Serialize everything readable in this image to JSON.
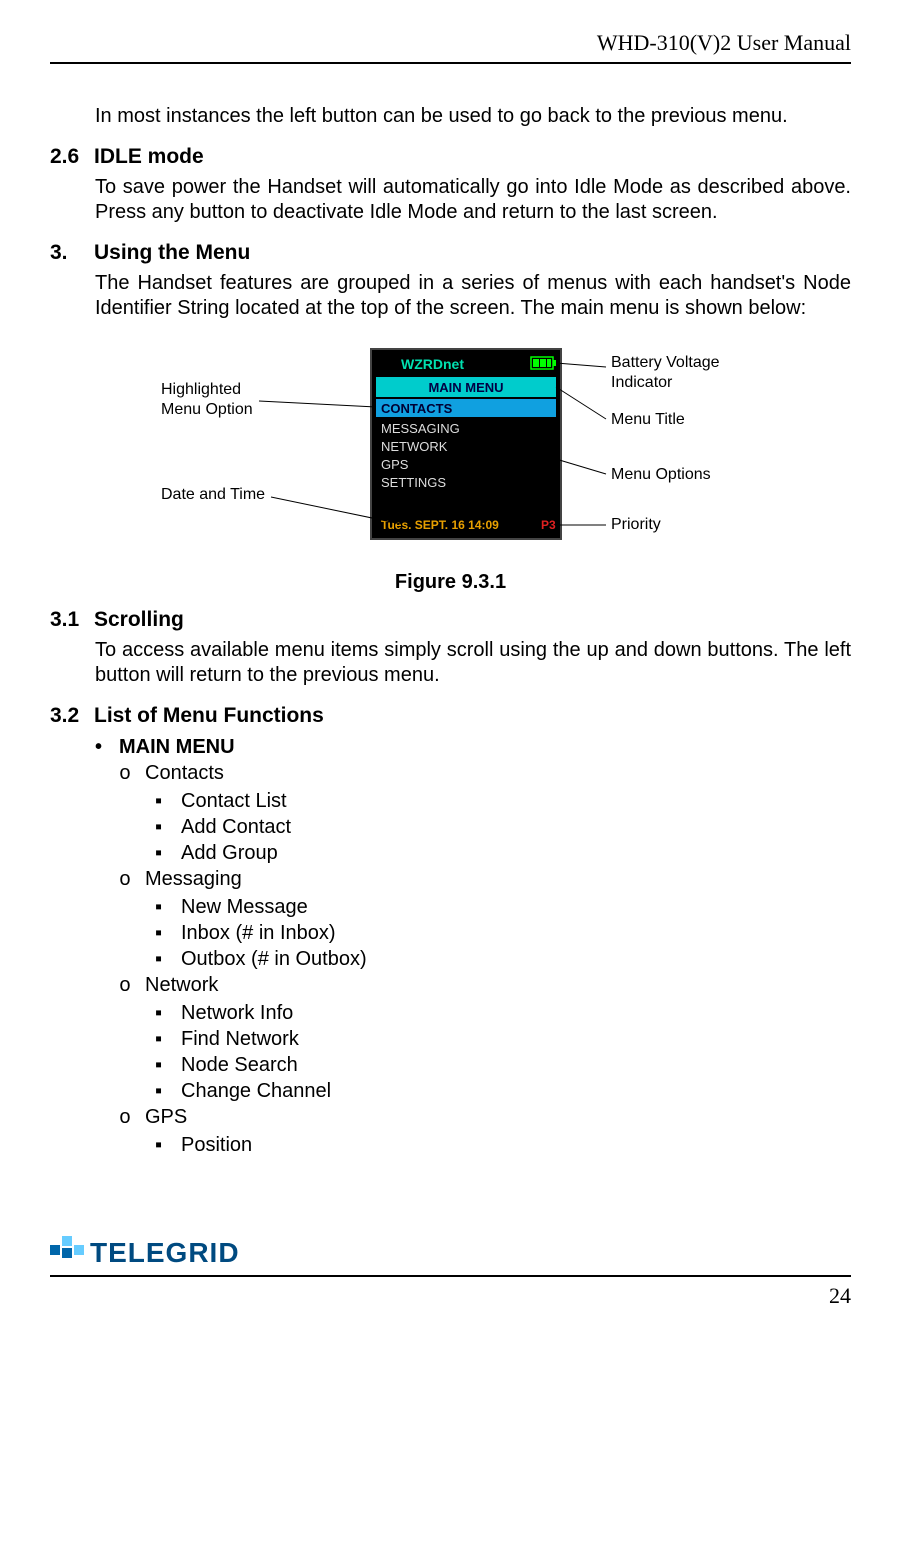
{
  "header": {
    "doc_title": "WHD-310(V)2 User Manual"
  },
  "intro_para": "In most instances the left button can be used to go back to the previous menu.",
  "sec_26": {
    "num": "2.6",
    "title": "IDLE mode",
    "body": "To save power the Handset will automatically go into Idle Mode as described above.  Press any button to deactivate Idle Mode and return to the last screen."
  },
  "sec_3": {
    "num": "3.",
    "title": "Using the Menu",
    "body": "The Handset features are grouped in a series of menus with each handset's Node Identifier String located at the top of the screen.  The main menu is shown below:"
  },
  "figure": {
    "caption": "Figure 9.3.1",
    "labels": {
      "highlighted": "Highlighted Menu Option",
      "date_time": "Date and Time",
      "battery": "Battery Voltage Indicator",
      "menu_title": "Menu Title",
      "menu_options": "Menu Options",
      "priority": "Priority"
    },
    "screen": {
      "node_id": "WZRDnet",
      "menu_title": "MAIN MENU",
      "items": [
        "CONTACTS",
        "MESSAGING",
        "NETWORK",
        "GPS",
        "SETTINGS"
      ],
      "datetime": "Tues. SEPT. 16 14:09",
      "priority": "P3"
    }
  },
  "sec_31": {
    "num": "3.1",
    "title": "Scrolling",
    "body": "To access available menu items simply scroll using the up and down buttons.  The left button will return to the previous menu."
  },
  "sec_32": {
    "num": "3.2",
    "title": "List of Menu Functions",
    "main_bullet": "MAIN MENU",
    "contacts": {
      "label": "Contacts",
      "items": [
        "Contact List",
        "Add Contact",
        "Add Group"
      ]
    },
    "messaging": {
      "label": "Messaging",
      "items": [
        "New Message",
        "Inbox (# in Inbox)",
        "Outbox (# in Outbox)"
      ]
    },
    "network": {
      "label": "Network",
      "items": [
        "Network Info",
        "Find Network",
        "Node Search",
        "Change Channel"
      ]
    },
    "gps": {
      "label": "GPS",
      "items": [
        "Position"
      ]
    }
  },
  "footer": {
    "logo_text": "TELEGRID",
    "page_num": "24"
  }
}
